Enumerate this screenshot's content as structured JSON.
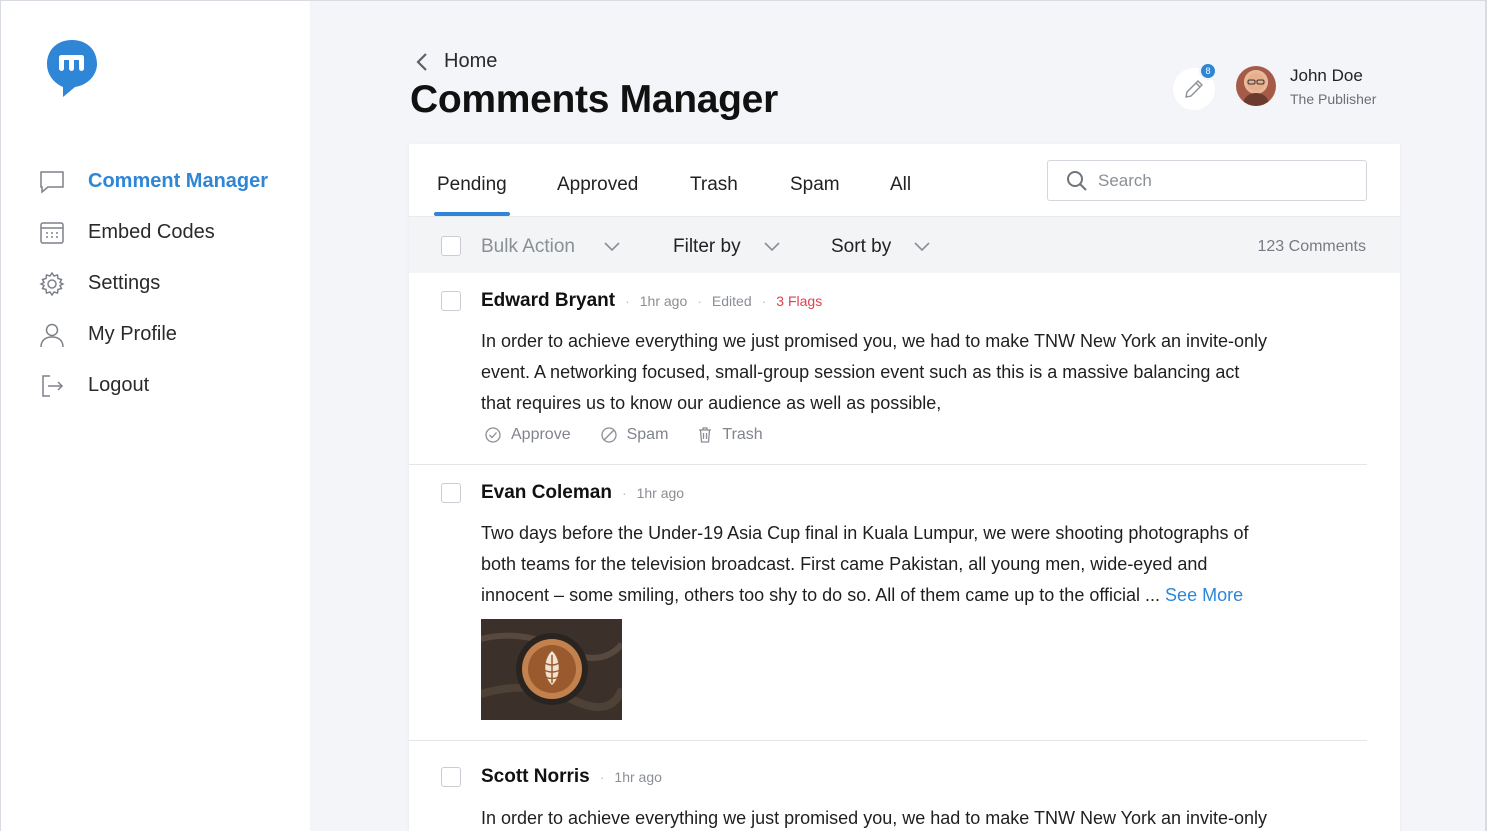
{
  "sidebar": {
    "items": [
      {
        "label": "Comment Manager",
        "icon": "chat-bubble-icon",
        "active": true
      },
      {
        "label": "Embed Codes",
        "icon": "calendar-grid-icon"
      },
      {
        "label": "Settings",
        "icon": "gear-icon"
      },
      {
        "label": "My Profile",
        "icon": "user-icon"
      },
      {
        "label": "Logout",
        "icon": "logout-icon"
      }
    ]
  },
  "header": {
    "back_label": "Home",
    "title": "Comments Manager",
    "notification_count": "8",
    "user": {
      "name": "John Doe",
      "role": "The Publisher"
    }
  },
  "tabs": [
    "Pending",
    "Approved",
    "Trash",
    "Spam",
    "All"
  ],
  "search": {
    "placeholder": "Search"
  },
  "toolbar": {
    "bulk_action": "Bulk Action",
    "filter_by": "Filter by",
    "sort_by": "Sort by",
    "count": "123 Comments"
  },
  "comments": [
    {
      "author": "Edward Bryant",
      "time": "1hr ago",
      "edited": "Edited",
      "flags": "3 Flags",
      "lines": [
        "In order to achieve everything we just promised you, we had to make TNW New York an invite-only",
        "event. A networking focused, small-group session event such as this is a massive balancing act",
        "that requires us to know our audience as well as possible,"
      ],
      "actions": {
        "approve": "Approve",
        "spam": "Spam",
        "trash": "Trash"
      }
    },
    {
      "author": "Evan Coleman",
      "time": "1hr ago",
      "lines": [
        "Two days before the Under-19 Asia Cup final in Kuala Lumpur, we were shooting photographs of",
        "both teams for the television broadcast. First came Pakistan, all young men, wide-eyed and",
        "innocent – some smiling, others too shy to do so. All of them came up to the official ..."
      ],
      "see_more": "See More"
    },
    {
      "author": "Scott Norris",
      "time": "1hr ago",
      "lines": [
        "In order to achieve everything we just promised you, we had to make TNW New York an invite-only"
      ]
    }
  ],
  "colors": {
    "accent": "#2f86d6",
    "flag": "#e0404f"
  }
}
